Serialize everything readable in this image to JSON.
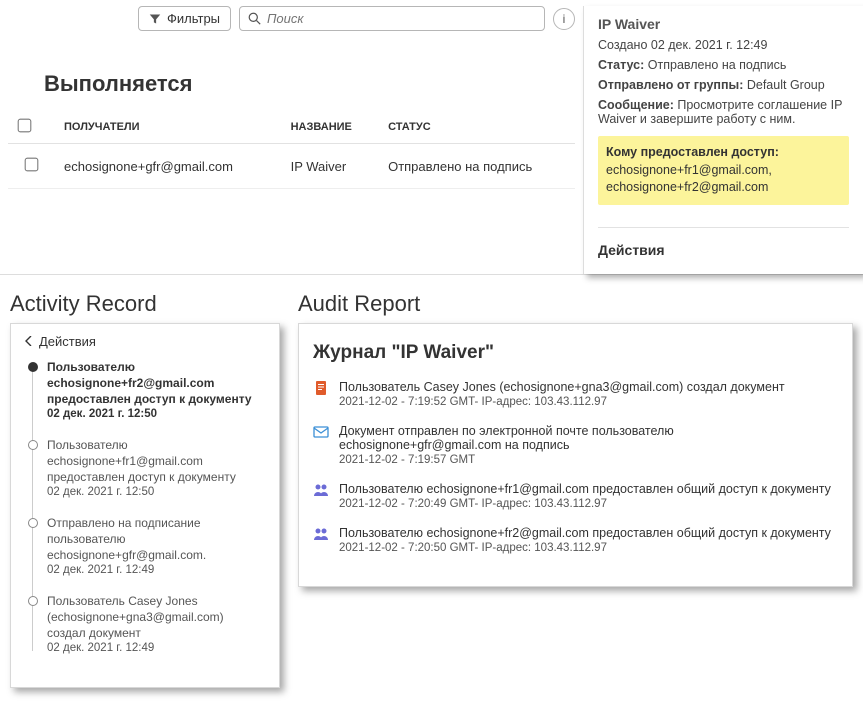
{
  "top": {
    "filters_label": "Фильтры",
    "search_placeholder": "Поиск",
    "section_title": "Выполняется",
    "columns": {
      "recipients": "ПОЛУЧАТЕЛИ",
      "title": "НАЗВАНИЕ",
      "status": "СТАТУС"
    },
    "rows": [
      {
        "recipient": "echosignone+gfr@gmail.com",
        "title": "IP Waiver",
        "status": "Отправлено на подпись"
      }
    ]
  },
  "detail": {
    "title": "IP Waiver",
    "created": "Создано 02 дек. 2021 г. 12:49",
    "status_label": "Статус:",
    "status_value": "Отправлено на подпись",
    "group_label": "Отправлено от группы:",
    "group_value": "Default Group",
    "message_label": "Сообщение:",
    "message_value": "Просмотрите соглашение IP Waiver и завершите работу с ним.",
    "shared_label": "Кому предоставлен доступ:",
    "shared_value": "echosignone+fr1@gmail.com, echosignone+fr2@gmail.com",
    "actions_h": "Действия"
  },
  "activity": {
    "heading": "Activity Record",
    "panel_title": "Действия",
    "items": [
      {
        "emph": true,
        "text": "Пользователю echosignone+fr2@gmail.com предоставлен доступ к документу",
        "date": "02 дек. 2021 г. 12:50"
      },
      {
        "emph": false,
        "text": "Пользователю echosignone+fr1@gmail.com предоставлен доступ к документу",
        "date": "02 дек. 2021 г. 12:50"
      },
      {
        "emph": false,
        "text": "Отправлено на подписание пользователю echosignone+gfr@gmail.com.",
        "date": "02 дек. 2021 г. 12:49"
      },
      {
        "emph": false,
        "text": "Пользователь Casey Jones (echosignone+gna3@gmail.com) создал документ",
        "date": "02 дек. 2021 г. 12:49"
      }
    ]
  },
  "audit": {
    "heading": "Audit Report",
    "journal_title": "Журнал \"IP Waiver\"",
    "entries": [
      {
        "icon": "doc",
        "text": "Пользователь Casey Jones (echosignone+gna3@gmail.com) создал документ",
        "meta": "2021-12-02 - 7:19:52 GMT- IP-адрес: 103.43.112.97"
      },
      {
        "icon": "mail",
        "text": "Документ отправлен по электронной почте пользователю echosignone+gfr@gmail.com на подпись",
        "meta": "2021-12-02 - 7:19:57 GMT"
      },
      {
        "icon": "share",
        "text": "Пользователю echosignone+fr1@gmail.com предоставлен общий доступ к документу",
        "meta": "2021-12-02 - 7:20:49 GMT- IP-адрес: 103.43.112.97"
      },
      {
        "icon": "share",
        "text": "Пользователю echosignone+fr2@gmail.com предоставлен общий доступ к документу",
        "meta": "2021-12-02 - 7:20:50 GMT- IP-адрес: 103.43.112.97"
      }
    ]
  }
}
